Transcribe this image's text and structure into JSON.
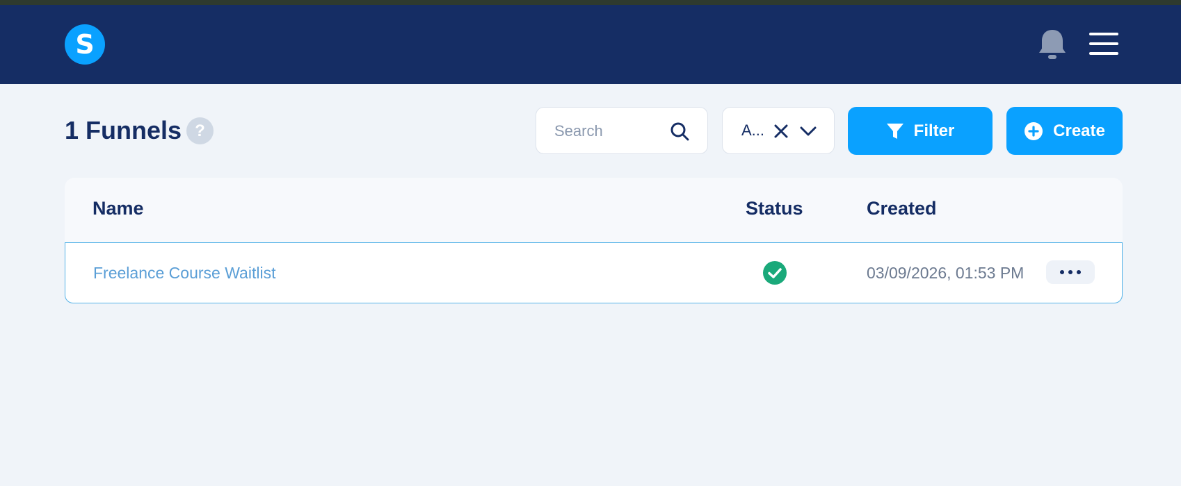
{
  "header": {
    "logo_letter": "S",
    "bell_icon": "bell-icon",
    "menu_icon": "hamburger-menu-icon",
    "colors": {
      "background": "#152d64",
      "logo": "#0aa1ff"
    }
  },
  "page": {
    "title": "1 Funnels",
    "help_icon_text": "?"
  },
  "toolbar": {
    "search": {
      "placeholder": "Search",
      "value": "",
      "icon": "search-icon"
    },
    "select": {
      "value": "A...",
      "clear_icon": "close-icon",
      "chevron_icon": "chevron-down-icon"
    },
    "filter_label": "Filter",
    "filter_icon": "funnel-icon",
    "create_label": "Create",
    "create_icon": "plus-circle-icon",
    "accent_color": "#0aa1ff"
  },
  "table": {
    "columns": [
      "Name",
      "Status",
      "Created"
    ],
    "rows": [
      {
        "name": "Freelance Course Waitlist",
        "status_icon": "check-circle-icon",
        "status_color": "#1aa97a",
        "created": "03/09/2026, 01:53 PM",
        "actions_icon": "more-horizontal-icon"
      }
    ]
  }
}
